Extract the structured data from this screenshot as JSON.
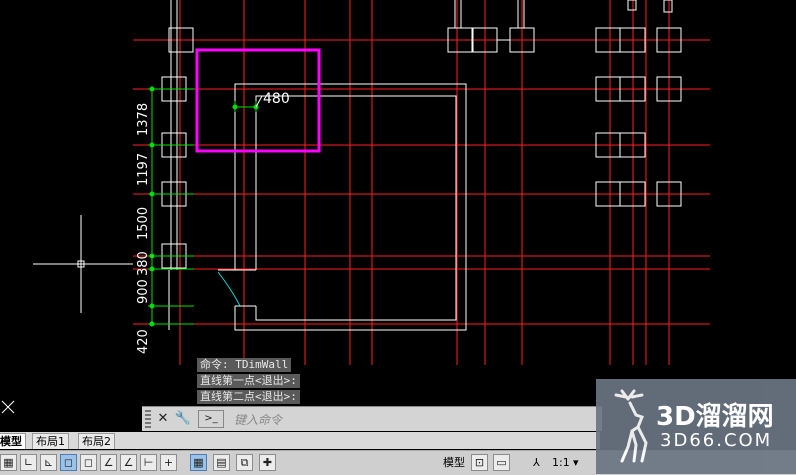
{
  "drawing": {
    "dimensions": [
      "1378",
      "1197",
      "1500",
      "380",
      "900",
      "420"
    ],
    "top_dim": "480"
  },
  "command": {
    "history": [
      "命令: TDimWall",
      "直线第一点<退出>:",
      "直线第二点<退出>:"
    ],
    "placeholder": "键入命令"
  },
  "tabs": [
    "模型",
    "布局1",
    "布局2"
  ],
  "status": {
    "model_label": "模型",
    "scale_label": "1:1"
  },
  "watermark": {
    "brand": "3D溜溜网",
    "domain": "3D66.COM"
  },
  "colors": {
    "background": "#000000",
    "axis_line": "#ff2020",
    "wall_line": "#ffffff",
    "dimension": "#00e000",
    "highlight": "#ff00ff",
    "door_arc": "#00e0e0"
  }
}
